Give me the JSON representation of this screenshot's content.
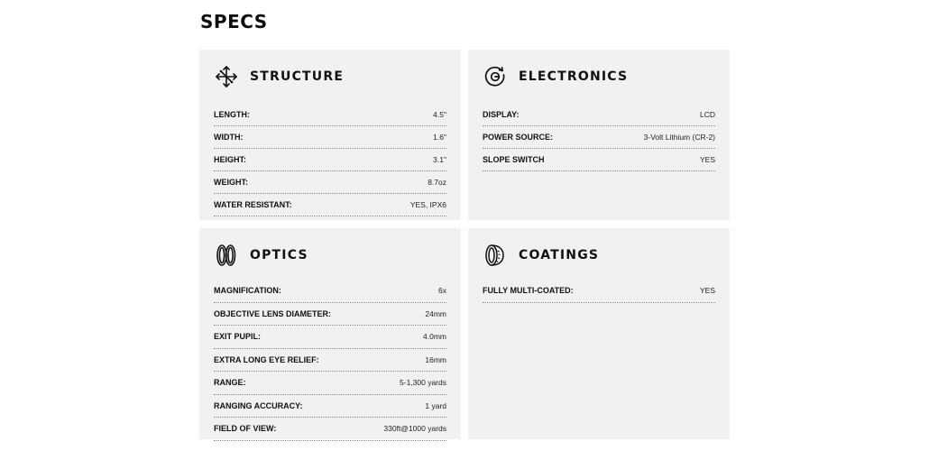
{
  "page": {
    "title": "SPECS"
  },
  "panels": [
    {
      "id": "structure",
      "icon": "structure-arrows-icon",
      "title": "STRUCTURE",
      "rows": [
        {
          "label": "LENGTH:",
          "value": "4.5\""
        },
        {
          "label": "WIDTH:",
          "value": "1.6\""
        },
        {
          "label": "HEIGHT:",
          "value": "3.1\""
        },
        {
          "label": "WEIGHT:",
          "value": "8.7oz"
        },
        {
          "label": "WATER RESISTANT:",
          "value": "YES, IPX6"
        }
      ]
    },
    {
      "id": "electronics",
      "icon": "electronics-icon",
      "title": "ELECTRONICS",
      "rows": [
        {
          "label": "DISPLAY:",
          "value": "LCD"
        },
        {
          "label": "POWER SOURCE:",
          "value": "3-Volt Lithium (CR-2)"
        },
        {
          "label": "SLOPE SWITCH",
          "value": "YES"
        }
      ]
    },
    {
      "id": "optics",
      "icon": "lens-rings-icon",
      "title": "OPTICS",
      "rows": [
        {
          "label": "MAGNIFICATION:",
          "value": "6x"
        },
        {
          "label": "OBJECTIVE LENS DIAMETER:",
          "value": "24mm"
        },
        {
          "label": "EXIT PUPIL:",
          "value": "4.0mm"
        },
        {
          "label": "EXTRA LONG EYE RELIEF:",
          "value": "16mm"
        },
        {
          "label": "RANGE:",
          "value": "5-1,300 yards"
        },
        {
          "label": "RANGING ACCURACY:",
          "value": "1 yard"
        },
        {
          "label": "FIELD OF VIEW:",
          "value": "330ft@1000 yards"
        }
      ]
    },
    {
      "id": "coatings",
      "icon": "coated-lens-icon",
      "title": "COATINGS",
      "rows": [
        {
          "label": "FULLY MULTI-COATED:",
          "value": "YES"
        }
      ]
    }
  ]
}
